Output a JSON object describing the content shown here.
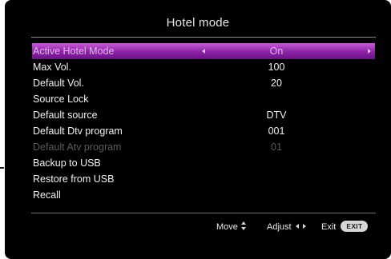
{
  "title": "Hotel mode",
  "menu": {
    "items": [
      {
        "label": "Active Hotel Mode",
        "value": "On"
      },
      {
        "label": "Max Vol.",
        "value": "100"
      },
      {
        "label": "Default Vol.",
        "value": "20"
      },
      {
        "label": "Source Lock",
        "value": ""
      },
      {
        "label": "Default source",
        "value": "DTV"
      },
      {
        "label": "Default Dtv program",
        "value": "001"
      },
      {
        "label": "Default Atv program",
        "value": "01"
      },
      {
        "label": "Backup to USB",
        "value": ""
      },
      {
        "label": "Restore from USB",
        "value": ""
      },
      {
        "label": "Recall",
        "value": ""
      }
    ]
  },
  "footer": {
    "move_label": "Move",
    "adjust_label": "Adjust",
    "exit_label": "Exit",
    "exit_badge": "EXIT",
    "move_icon": "updown-arrows-icon",
    "adjust_icon": "leftright-arrows-icon"
  },
  "colors": {
    "highlight_top": "#c85cd6",
    "highlight_bottom": "#6a1486",
    "disabled_text": "#5a5a5a",
    "background": "#000000"
  }
}
